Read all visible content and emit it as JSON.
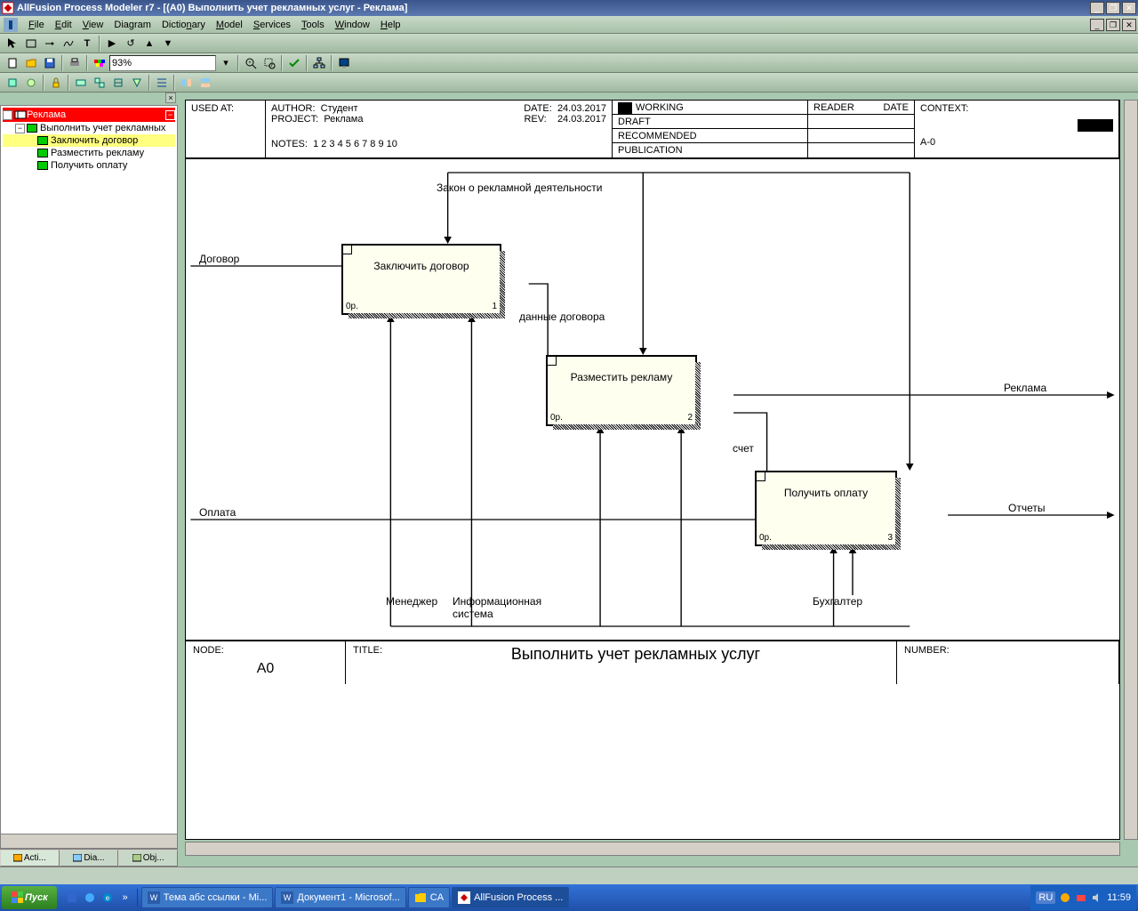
{
  "title": "AllFusion Process Modeler r7 - [(A0) Выполнить учет рекламных услуг - Реклама]",
  "menu": [
    "File",
    "Edit",
    "View",
    "Diagram",
    "Dictionary",
    "Model",
    "Services",
    "Tools",
    "Window",
    "Help"
  ],
  "zoom": "93%",
  "tree": {
    "root": "Реклама",
    "child0": "Выполнить учет рекламных",
    "c1": "Заключить договор",
    "c2": "Разместить рекламу",
    "c3": "Получить оплату"
  },
  "treetabs": [
    "Acti...",
    "Dia...",
    "Obj..."
  ],
  "idef": {
    "usedat": "USED AT:",
    "author_l": "AUTHOR:",
    "author": "Студент",
    "project_l": "PROJECT:",
    "project": "Реклама",
    "notes_l": "NOTES:",
    "notes": "1  2  3  4  5  6  7  8  9  10",
    "date_l": "DATE:",
    "date": "24.03.2017",
    "rev_l": "REV:",
    "rev": "24.03.2017",
    "working": "WORKING",
    "draft": "DRAFT",
    "recommended": "RECOMMENDED",
    "publication": "PUBLICATION",
    "reader": "READER",
    "datecol": "DATE",
    "context": "CONTEXT:",
    "contextval": "A-0",
    "node_l": "NODE:",
    "node": "A0",
    "title_l": "TITLE:",
    "title": "Выполнить учет рекламных услуг",
    "number_l": "NUMBER:"
  },
  "boxes": {
    "b1": {
      "name": "Заключить договор",
      "cost": "0р.",
      "num": "1"
    },
    "b2": {
      "name": "Разместить рекламу",
      "cost": "0р.",
      "num": "2"
    },
    "b3": {
      "name": "Получить оплату",
      "cost": "0р.",
      "num": "3"
    }
  },
  "arrows": {
    "top": "Закон о рекламной деятельности",
    "in1": "Договор",
    "in2": "Оплата",
    "mid1": "данные договора",
    "mid2": "счет",
    "out1": "Реклама",
    "out2": "Отчеты",
    "mech1": "Менеджер",
    "mech2": "Информационная\nсистема",
    "mech3": "Бухгалтер"
  },
  "taskbar": {
    "start": "Пуск",
    "tasks": [
      "Тема абс ссылки - Mi...",
      "Документ1 - Microsof...",
      "CA",
      "AllFusion Process ..."
    ],
    "lang": "RU",
    "time": "11:59"
  }
}
